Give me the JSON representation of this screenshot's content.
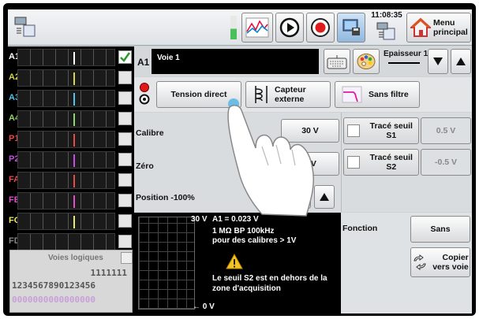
{
  "toolbar": {
    "time": "11:08:35",
    "menu_label_1": "Menu",
    "menu_label_2": "principal"
  },
  "channels": [
    {
      "label": "A1",
      "color": "#ffffff",
      "checked": true
    },
    {
      "label": "A2",
      "color": "#d6d64a",
      "checked": false
    },
    {
      "label": "A3",
      "color": "#4fc6e8",
      "checked": false
    },
    {
      "label": "A4",
      "color": "#8fd66a",
      "checked": false
    },
    {
      "label": "P1",
      "color": "#e64b4b",
      "checked": false
    },
    {
      "label": "P2",
      "color": "#c44fe0",
      "checked": false
    },
    {
      "label": "FA",
      "color": "#e64b4b",
      "checked": false
    },
    {
      "label": "FB",
      "color": "#e04fd0",
      "checked": false
    },
    {
      "label": "FC",
      "color": "#e8e86a",
      "checked": false
    },
    {
      "label": "FD",
      "color": "#888888",
      "checked": false
    }
  ],
  "logic": {
    "title": "Voies logiques",
    "row1": "1111111",
    "row2": "1234567890123456",
    "row3": "0000000000000000"
  },
  "channel_header": {
    "id": "A1",
    "name": "Voie 1",
    "thickness_label": "Epaisseur 1"
  },
  "input": {
    "tension_direct": "Tension direct",
    "capteur_1": "Capteur",
    "capteur_2": "externe",
    "sans_filtre": "Sans filtre"
  },
  "settings": {
    "calibre_label": "Calibre",
    "calibre_value": "30 V",
    "zero_label": "Zéro",
    "zero_value": "0 V",
    "position_label": "Position -100%",
    "seuil_s1_label": "Tracé seuil S1",
    "seuil_s1_value": "0.5 V",
    "seuil_s2_label": "Tracé seuil S2",
    "seuil_s2_value": "-0.5 V",
    "fonction_label": "Fonction",
    "fonction_value": "Sans",
    "copier_1": "Copier",
    "copier_2": "vers voie"
  },
  "scope": {
    "top_scale": "30 V",
    "bottom_scale": "← 0 V",
    "a1_value": "A1 =  0.023 V",
    "bp_1": "1 MΩ BP 100kHz",
    "bp_2": "pour des calibres > 1V",
    "warn_1": "Le seuil S2 est en dehors de la",
    "warn_2": "zone d'acquisition"
  }
}
